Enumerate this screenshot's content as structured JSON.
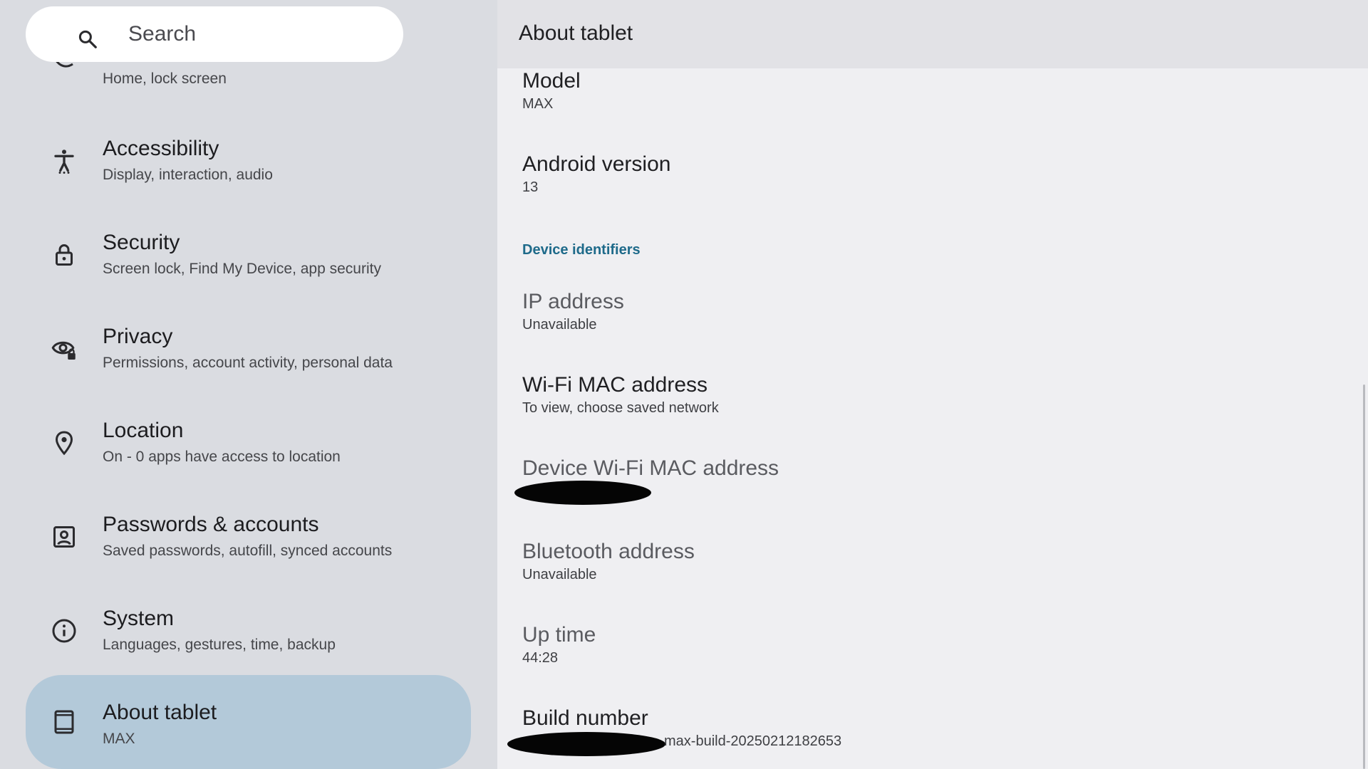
{
  "search": {
    "placeholder": "Search"
  },
  "nav": {
    "partial_item": {
      "subtitle": "Home, lock screen"
    },
    "items": [
      {
        "icon": "accessibility-icon",
        "title": "Accessibility",
        "subtitle": "Display, interaction, audio"
      },
      {
        "icon": "lock-icon",
        "title": "Security",
        "subtitle": "Screen lock, Find My Device, app security"
      },
      {
        "icon": "privacy-eye-icon",
        "title": "Privacy",
        "subtitle": "Permissions, account activity, personal data"
      },
      {
        "icon": "location-pin-icon",
        "title": "Location",
        "subtitle": "On - 0 apps have access to location"
      },
      {
        "icon": "account-box-icon",
        "title": "Passwords & accounts",
        "subtitle": "Saved passwords, autofill, synced accounts"
      },
      {
        "icon": "info-icon",
        "title": "System",
        "subtitle": "Languages, gestures, time, backup"
      },
      {
        "icon": "tablet-icon",
        "title": "About tablet",
        "subtitle": "MAX",
        "selected": true
      }
    ]
  },
  "detail": {
    "header_title": "About tablet",
    "model": {
      "title": "Model",
      "value": "MAX"
    },
    "android_version": {
      "title": "Android version",
      "value": "13"
    },
    "section_label": "Device identifiers",
    "ip_address": {
      "title": "IP address",
      "value": "Unavailable"
    },
    "wifi_mac": {
      "title": "Wi-Fi MAC address",
      "value": "To view, choose saved network"
    },
    "device_wifi_mac": {
      "title": "Device Wi-Fi MAC address",
      "value": ""
    },
    "bluetooth_address": {
      "title": "Bluetooth address",
      "value": "Unavailable"
    },
    "up_time": {
      "title": "Up time",
      "value": "44:28"
    },
    "build_number": {
      "title": "Build number",
      "value_suffix": "max-build-20250212182653"
    }
  },
  "colors": {
    "left_pane_bg": "#dadce1",
    "right_pane_bg": "#efeff2",
    "selected_item_bg": "#b3c9d9",
    "section_label": "#1e6a8a"
  }
}
